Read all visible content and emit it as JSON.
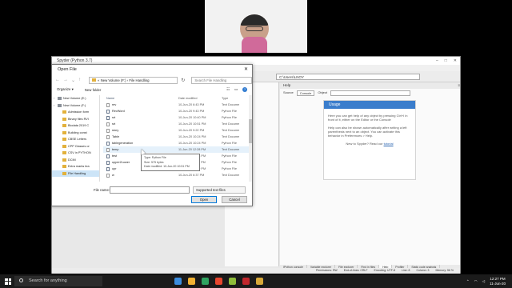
{
  "spyder": {
    "title": "Spyder (Python 3.7)",
    "path": "C:\\Users\\LNOY",
    "help": {
      "header": "Help",
      "source_label": "Source",
      "source_value": "Console",
      "object_label": "Object",
      "usage_title": "Usage",
      "usage_p1": "Here you can get help of any object by pressing Ctrl+I in front of it, either on the Editor or the Console",
      "usage_p2": "Help can also be shown automatically after writing a left parenthesis next to an object. You can activate this behavior in Preferences > Help.",
      "usage_nav_prefix": "New to Spyder? Read our",
      "usage_nav_link": "tutorial"
    },
    "bottom_tabs": [
      "IPython console",
      "Variable explorer",
      "File explorer",
      "Find in files",
      "Help",
      "Profiler",
      "Static code analysis"
    ],
    "status": {
      "permissions": "Permissions: RW",
      "eol": "End-of-lines: CRLF",
      "encoding": "Encoding: UTF-8",
      "line": "Line: 8",
      "column": "Column: 3",
      "memory": "Memory: 56 %"
    }
  },
  "dialog": {
    "title": "Open File",
    "close": "✕",
    "breadcrumb": "« New Volume (F:) › File Handling",
    "search_placeholder": "Search File Handling",
    "organize": "Organize ▾",
    "new_folder": "New folder",
    "tree": [
      {
        "label": "New Volume (E:)",
        "kind": "drive"
      },
      {
        "label": "New Volume (F:)",
        "kind": "drive"
      },
      {
        "label": "Admission form",
        "kind": "folder"
      },
      {
        "label": "Binary files RVI",
        "kind": "folder"
      },
      {
        "label": "Biodata 2019 C",
        "kind": "folder"
      },
      {
        "label": "Building const",
        "kind": "folder"
      },
      {
        "label": "CBSE Letters",
        "kind": "folder"
      },
      {
        "label": "CPP Classes or",
        "kind": "folder"
      },
      {
        "label": "CSV in PYTHON",
        "kind": "folder"
      },
      {
        "label": "DCIM",
        "kind": "folder"
      },
      {
        "label": "Extra marks tea",
        "kind": "folder"
      },
      {
        "label": "File Handling",
        "kind": "folder",
        "selected": true
      }
    ],
    "columns": {
      "name": "Name",
      "date": "Date modified",
      "type": "Type"
    },
    "files": [
      {
        "name": "rev",
        "date": "10-Jun-20 6:43 PM",
        "type": "Text Docume",
        "icon": "text"
      },
      {
        "name": "RevWord",
        "date": "10-Jun-20 9:43 PM",
        "type": "Python File",
        "icon": "python"
      },
      {
        "name": "srt",
        "date": "10-Jun-20 10:40 PM",
        "type": "Python File",
        "icon": "python"
      },
      {
        "name": "srt",
        "date": "10-Jun-20 10:51 PM",
        "type": "Text Docume",
        "icon": "text"
      },
      {
        "name": "story",
        "date": "10-Jun-20 9:22 PM",
        "type": "Text Docume",
        "icon": "text"
      },
      {
        "name": "Table",
        "date": "10-Jun-20 10:24 PM",
        "type": "Text Docume",
        "icon": "text"
      },
      {
        "name": "tablegeneration",
        "date": "10-Jun-20 10:24 PM",
        "type": "Python File",
        "icon": "python"
      },
      {
        "name": "temp",
        "date": "11-Jun-20 12:28 PM",
        "type": "Text Docume",
        "icon": "text",
        "hover": true
      },
      {
        "name": "test",
        "date": "11-Jun-20 10:38 PM",
        "type": "Python File",
        "icon": "python"
      },
      {
        "name": "upper2Lower",
        "date": "11-Jun-20 11:04 PM",
        "type": "Python File",
        "icon": "python"
      },
      {
        "name": "upr",
        "date": "10-Jun-20 11:09 PM",
        "type": "Python File",
        "icon": "python"
      },
      {
        "name": "w",
        "date": "10-Jun-20 6:37 PM",
        "type": "Text Docume",
        "icon": "text"
      }
    ],
    "tooltip": [
      "Type: Python File",
      "Size: 575 bytes",
      "Date modified: 10-Jun-20 10:51 PM"
    ],
    "filename_label": "File name:",
    "filetype": "Supported text files",
    "open_label": "Open",
    "cancel_label": "Cancel"
  },
  "taskbar": {
    "search_placeholder": "Search for anything",
    "time": "12:27 PM",
    "date": "11-Jun-20",
    "app_colors": [
      "#3c8dde",
      "#f2b233",
      "#2fa360",
      "#e8462e",
      "#8fbd3a",
      "#c1272d",
      "#d8a838"
    ]
  }
}
